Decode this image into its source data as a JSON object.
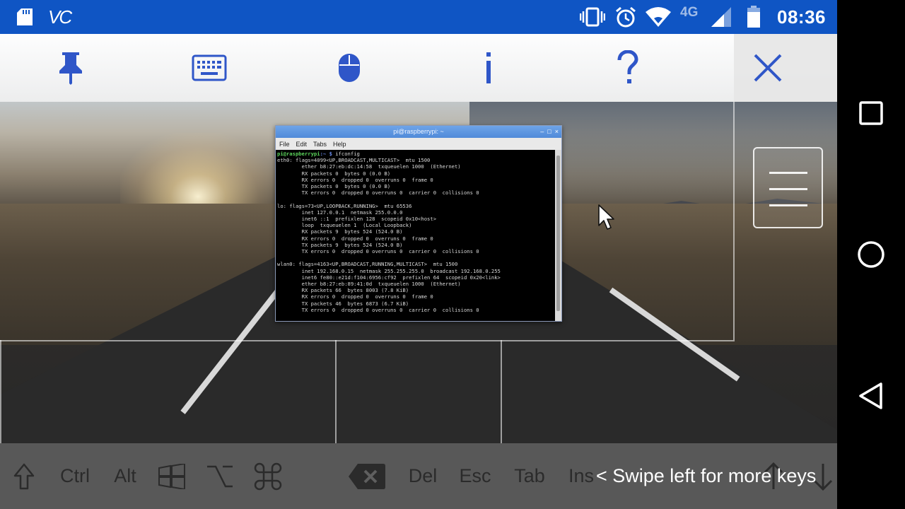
{
  "status_bar": {
    "carrier_label": "VC",
    "network_type": "4G",
    "time": "08:36",
    "icons": [
      "sd-card-icon",
      "vc-logo-icon",
      "vibrate-icon",
      "alarm-icon",
      "wifi-icon",
      "signal-icon",
      "battery-icon"
    ]
  },
  "control_bar": {
    "buttons": [
      {
        "name": "pin-icon",
        "action": "pin"
      },
      {
        "name": "keyboard-icon",
        "action": "keyboard"
      },
      {
        "name": "mouse-icon",
        "action": "mouse"
      },
      {
        "name": "info-icon",
        "action": "info"
      },
      {
        "name": "help-icon",
        "action": "help"
      },
      {
        "name": "close-icon",
        "action": "close"
      }
    ]
  },
  "terminal": {
    "title": "pi@raspberrypi: ~",
    "controls": [
      "–",
      "□",
      "×"
    ],
    "menu": [
      "File",
      "Edit",
      "Tabs",
      "Help"
    ],
    "prompt_user": "pi@raspberrypi",
    "prompt_path": ":~ $",
    "command": " ifconfig",
    "output": "eth0: flags=4099<UP,BROADCAST,MULTICAST>  mtu 1500\n        ether b8:27:eb:dc:14:58  txqueuelen 1000  (Ethernet)\n        RX packets 0  bytes 0 (0.0 B)\n        RX errors 0  dropped 0  overruns 0  frame 0\n        TX packets 0  bytes 0 (0.0 B)\n        TX errors 0  dropped 0 overruns 0  carrier 0  collisions 0\n\nlo: flags=73<UP,LOOPBACK,RUNNING>  mtu 65536\n        inet 127.0.0.1  netmask 255.0.0.0\n        inet6 ::1  prefixlen 128  scopeid 0x10<host>\n        loop  txqueuelen 1  (Local Loopback)\n        RX packets 9  bytes 524 (524.0 B)\n        RX errors 0  dropped 0  overruns 0  frame 0\n        TX packets 9  bytes 524 (524.0 B)\n        TX errors 0  dropped 0 overruns 0  carrier 0  collisions 0\n\nwlan0: flags=4163<UP,BROADCAST,RUNNING,MULTICAST>  mtu 1500\n        inet 192.168.0.15  netmask 255.255.255.0  broadcast 192.168.0.255\n        inet6 fe80::e21d:f104:6956:cf92  prefixlen 64  scopeid 0x20<link>\n        ether b8:27:eb:89:41:0d  txqueuelen 1000  (Ethernet)\n        RX packets 66  bytes 8003 (7.8 KiB)\n        RX errors 0  dropped 0  overruns 0  frame 0\n        TX packets 46  bytes 6873 (6.7 KiB)\n        TX errors 0  dropped 0 overruns 0  carrier 0  collisions 0"
  },
  "keys_bar": {
    "keys": {
      "shift": "shift-icon",
      "ctrl": "Ctrl",
      "alt": "Alt",
      "win": "windows-icon",
      "option": "option-icon",
      "cmd": "command-icon",
      "backspace": "backspace-icon",
      "del": "Del",
      "esc": "Esc",
      "tab": "Tab",
      "ins": "Ins"
    },
    "hint": "< Swipe left for more keys"
  },
  "colors": {
    "status_bar": "#0f55c4",
    "accent_icon": "#2f56c8",
    "terminal_prompt_user": "#5bd35b",
    "terminal_prompt_path": "#6c8ef0"
  }
}
